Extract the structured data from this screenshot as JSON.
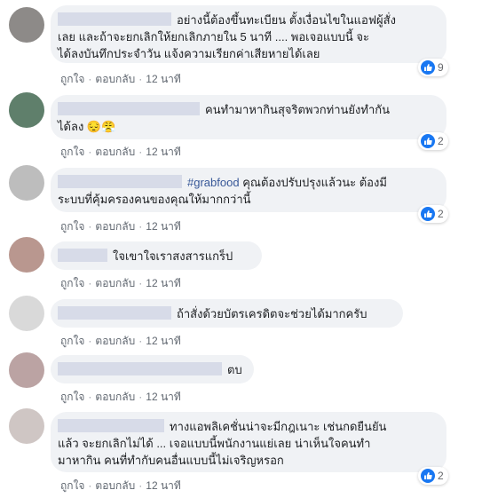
{
  "meta": {
    "like": "ถูกใจ",
    "reply": "ตอบกลับ",
    "sep": "·",
    "time": "12 นาที"
  },
  "comments": [
    {
      "lines": [
        "อย่างนี้ต้องขึ้นทะเบียน ตั้งเงื่อนไขในแอฟผู้สั่ง",
        "เลย และถ้าจะยกเลิกให้ยกเลิกภายใน 5 นาที .... พอเจอแบบนี้ จะ",
        "ได้ลงบันทึกประจำวัน แจ้งความเรียกค่าเสียหายได้เลย"
      ],
      "likes": "9",
      "avatar_color": "#8d8a88"
    },
    {
      "lines": [
        "คนทำมาหากินสุจริตพวกท่านยังทำกัน",
        "ได้ลง"
      ],
      "emoji": [
        "😔",
        "😤"
      ],
      "likes": "2",
      "avatar_color": "#5f7f6b"
    },
    {
      "tag": "#grabfood",
      "lines": [
        "คุณต้องปรับปรุงแล้วนะ ต้องมี",
        "ระบบที่คุ้มครองคนของคุณให้มากกว่านี้"
      ],
      "likes": "2",
      "avatar_color": "#bdbdbd"
    },
    {
      "lines": [
        "ใจเขาใจเราสงสารแกร็ป"
      ],
      "avatar_color": "#b9978f"
    },
    {
      "lines": [
        "ถ้าสั่งด้วยบัตรเครดิตจะช่วยได้มากครับ"
      ],
      "avatar_color": "#d9d9d9"
    },
    {
      "lines": [
        "ตบ"
      ],
      "avatar_color": "#bba3a3"
    },
    {
      "lines": [
        "ทางแอพลิเคชั่นน่าจะมีกฎเนาะ เช่นกดยืนยัน",
        "แล้ว จะยกเลิกไม่ได้ ... เจอแบบนี้พนักงานแย่เลย น่าเห็นใจคนทำ",
        "มาหากิน คนที่ทำกับคนอื่นแบบนี้ไม่เจริญหรอก"
      ],
      "likes": "2",
      "avatar_color": "#cfc6c4"
    }
  ]
}
